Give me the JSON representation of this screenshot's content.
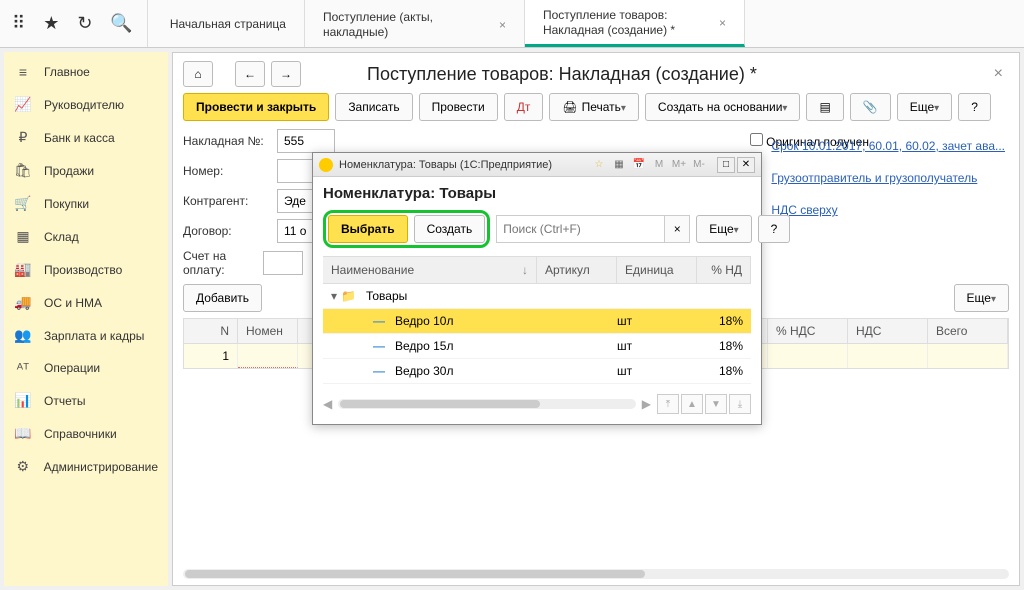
{
  "top_tabs": [
    "Начальная страница",
    "Поступление (акты, накладные)",
    "Поступление товаров: Накладная (создание) *"
  ],
  "sidebar": [
    {
      "icon": "≡",
      "label": "Главное"
    },
    {
      "icon": "📈",
      "label": "Руководителю"
    },
    {
      "icon": "₽",
      "label": "Банк и касса"
    },
    {
      "icon": "🛍",
      "label": "Продажи"
    },
    {
      "icon": "🛒",
      "label": "Покупки"
    },
    {
      "icon": "▦",
      "label": "Склад"
    },
    {
      "icon": "🏭",
      "label": "Производство"
    },
    {
      "icon": "🚚",
      "label": "ОС и НМА"
    },
    {
      "icon": "👥",
      "label": "Зарплата и кадры"
    },
    {
      "icon": "ᴬᵀ",
      "label": "Операции"
    },
    {
      "icon": "📊",
      "label": "Отчеты"
    },
    {
      "icon": "📖",
      "label": "Справочники"
    },
    {
      "icon": "⚙",
      "label": "Администрирование"
    }
  ],
  "page": {
    "title": "Поступление товаров: Накладная (создание) *"
  },
  "toolbar": {
    "primary": "Провести и закрыть",
    "save": "Записать",
    "post": "Провести",
    "print": "Печать",
    "create_based": "Создать на основании",
    "more": "Еще"
  },
  "form": {
    "invoice_label": "Накладная №:",
    "invoice": "555",
    "number_label": "Номер:",
    "counterparty_label": "Контрагент:",
    "counterparty": "Эде",
    "contract_label": "Договор:",
    "contract": "11 о",
    "account_label": "Счет на оплату:",
    "original_label": "Оригинал получен"
  },
  "links": {
    "l1": "Срок 10.01.2017, 60.01, 60.02, зачет ава...",
    "l2": "Грузоотправитель и грузополучатель",
    "l3": "НДС сверху"
  },
  "table": {
    "add": "Добавить",
    "more": "Еще",
    "cols": {
      "n": "N",
      "nomen": "Номен",
      "pctnds": "% НДС",
      "nds": "НДС",
      "total": "Всего"
    },
    "row1_n": "1"
  },
  "modal": {
    "titlebar": "Номенклатура: Товары  (1С:Предприятие)",
    "heading": "Номенклатура: Товары",
    "select": "Выбрать",
    "create": "Создать",
    "search_ph": "Поиск (Ctrl+F)",
    "more": "Еще",
    "cols": {
      "name": "Наименование",
      "art": "Артикул",
      "unit": "Единица",
      "nds": "% НД"
    },
    "folder": "Товары",
    "rows": [
      {
        "name": "Ведро 10л",
        "unit": "шт",
        "nds": "18%"
      },
      {
        "name": "Ведро 15л",
        "unit": "шт",
        "nds": "18%"
      },
      {
        "name": "Ведро 30л",
        "unit": "шт",
        "nds": "18%"
      }
    ],
    "m_icons": [
      "M",
      "M+",
      "M-"
    ]
  }
}
